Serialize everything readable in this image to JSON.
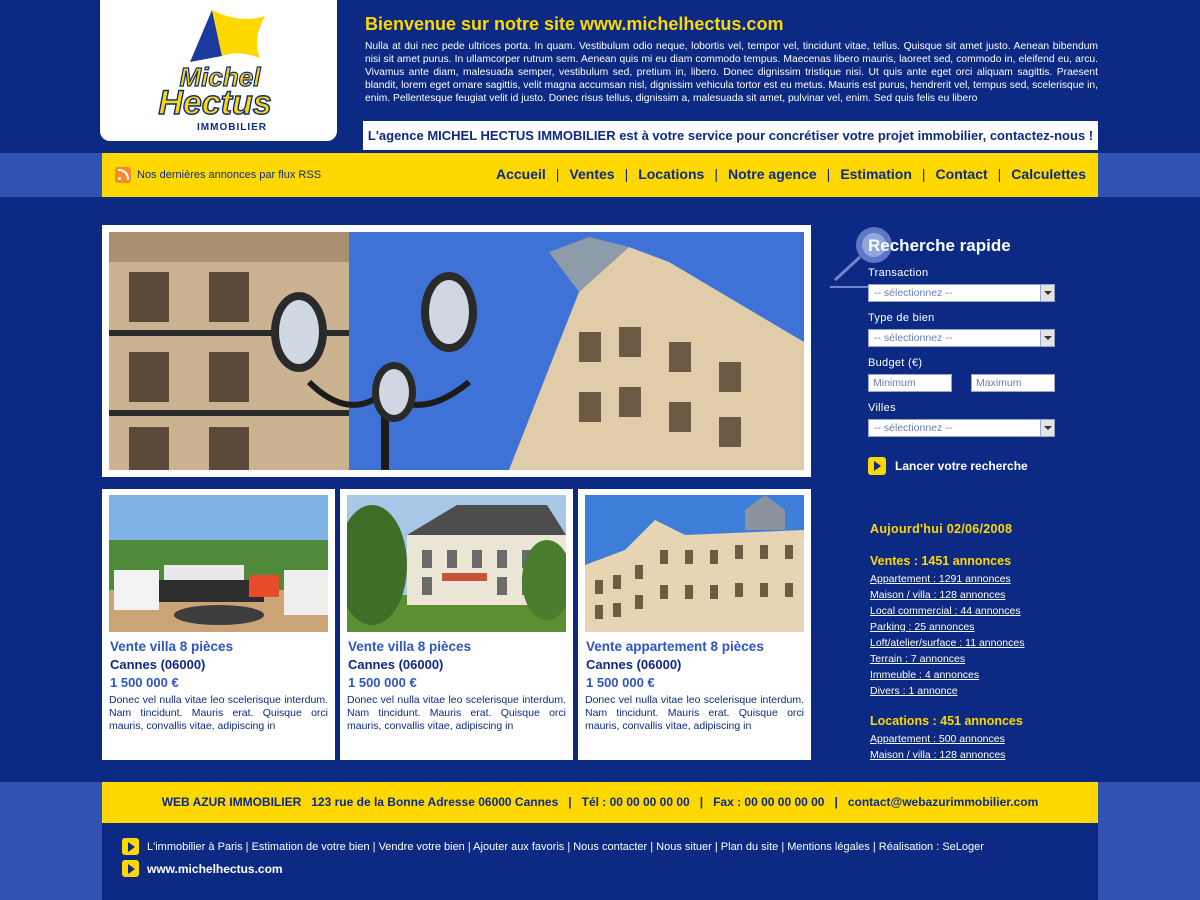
{
  "header": {
    "logo_line1": "Michel",
    "logo_line2": "Hectus",
    "logo_line3": "IMMOBILIER",
    "welcome_title": "Bienvenue sur notre site www.michelhectus.com",
    "intro_text": "Nulla at dui nec pede ultrices porta. In quam. Vestibulum odio neque, lobortis vel, tempor vel, tincidunt vitae, tellus. Quisque sit amet justo. Aenean bibendum nisi sit amet purus. In ullamcorper rutrum sem. Aenean quis mi eu diam commodo tempus. Maecenas libero mauris, laoreet sed, commodo in, eleifend eu, arcu. Vivamus ante diam, malesuada semper, vestibulum sed, pretium in, libero. Donec dignissim tristique nisi. Ut quis ante eget orci aliquam sagittis. Praesent blandit, lorem eget ornare sagittis, velit magna accumsan nisl, dignissim vehicula tortor est eu metus. Mauris est purus, hendrerit vel, tempus sed, scelerisque in, enim. Pellentesque feugiat velit id justo. Donec risus tellus, dignissim a, malesuada sit amet, pulvinar vel, enim. Sed quis felis eu libero",
    "tagline": "L'agence MICHEL HECTUS IMMOBILIER est à votre service pour concrétiser votre projet immobilier, contactez-nous !"
  },
  "nav": {
    "rss_label": "Nos dernières annonces par flux RSS",
    "items": [
      "Accueil",
      "Ventes",
      "Locations",
      "Notre agence",
      "Estimation",
      "Contact",
      "Calculettes"
    ]
  },
  "listings": [
    {
      "title": "Vente villa 8 pièces",
      "city": "Cannes (06000)",
      "price": "1 500 000 €",
      "desc": "Donec vel nulla vitae leo scelerisque interdum. Nam tincidunt. Mauris erat. Quisque orci mauris, convallis vitae, adipiscing in"
    },
    {
      "title": "Vente villa 8 pièces",
      "city": "Cannes (06000)",
      "price": "1 500 000 €",
      "desc": "Donec vel nulla vitae leo scelerisque interdum. Nam tincidunt. Mauris erat. Quisque orci mauris, convallis vitae, adipiscing in"
    },
    {
      "title": "Vente appartement 8 pièces",
      "city": "Cannes (06000)",
      "price": "1 500 000 €",
      "desc": "Donec vel nulla vitae leo scelerisque interdum. Nam tincidunt. Mauris erat. Quisque orci mauris, convallis vitae, adipiscing in"
    }
  ],
  "search": {
    "title": "Recherche rapide",
    "transaction_label": "Transaction",
    "transaction_value": "-- sélectionnez --",
    "type_label": "Type de bien",
    "type_value": "-- sélectionnez --",
    "budget_label": "Budget (€)",
    "min_placeholder": "Minimum",
    "max_placeholder": "Maximum",
    "villes_label": "Villes",
    "villes_value": "-- sélectionnez --",
    "launch_label": "Lancer votre recherche"
  },
  "stats": {
    "today": "Aujourd'hui 02/06/2008",
    "ventes_head": "Ventes : 1451 annonces",
    "ventes": [
      "Appartement : 1291 annonces",
      "Maison / villa : 128 annonces",
      "Local commercial : 44 annonces",
      "Parking : 25 annonces",
      "Loft/atelier/surface : 11 annonces",
      "Terrain : 7 annonces",
      "Immeuble : 4 annonces",
      "Divers : 1 annonce"
    ],
    "locations_head": "Locations : 451 annonces",
    "locations": [
      "Appartement : 500 annonces",
      "Maison / villa : 128 annonces"
    ]
  },
  "footer": {
    "contact_line": "WEB AZUR IMMOBILIER   123 rue de la Bonne Adresse 06000 Cannes   |   Tél : 00 00 00 00 00   |   Fax : 00 00 00 00 00   |   contact@webazurimmobilier.com",
    "links": "L'immobilier à Paris  | Estimation de votre bien  | Vendre votre bien | Ajouter aux favoris | Nous contacter | Nous situer | Plan du site | Mentions légales | Réalisation : SeLoger",
    "site": "www.michelhectus.com"
  },
  "colors": {
    "background": "#0c2a84",
    "accent_yellow": "#ffd800",
    "side_strip": "#3154b3",
    "link_blue": "#2e55c2"
  }
}
